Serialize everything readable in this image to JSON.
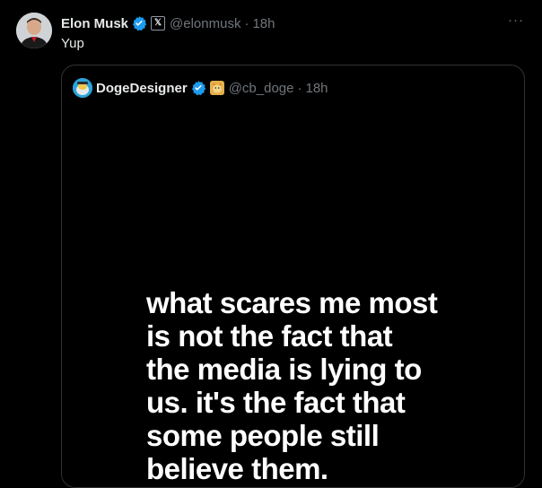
{
  "tweet": {
    "author_name": "Elon Musk",
    "affiliation_badge": "𝕏",
    "handle": "@elonmusk",
    "separator": "·",
    "time": "18h",
    "more_label": "···",
    "text": "Yup",
    "verified_color": "#1d9bf0"
  },
  "quoted": {
    "author_name": "DogeDesigner",
    "handle": "@cb_doge",
    "separator": "·",
    "time": "18h",
    "media_lines": [
      "what scares me most",
      "is not the fact that",
      "the media is lying to",
      "us. it's the fact that",
      "some people still",
      "believe them."
    ]
  }
}
